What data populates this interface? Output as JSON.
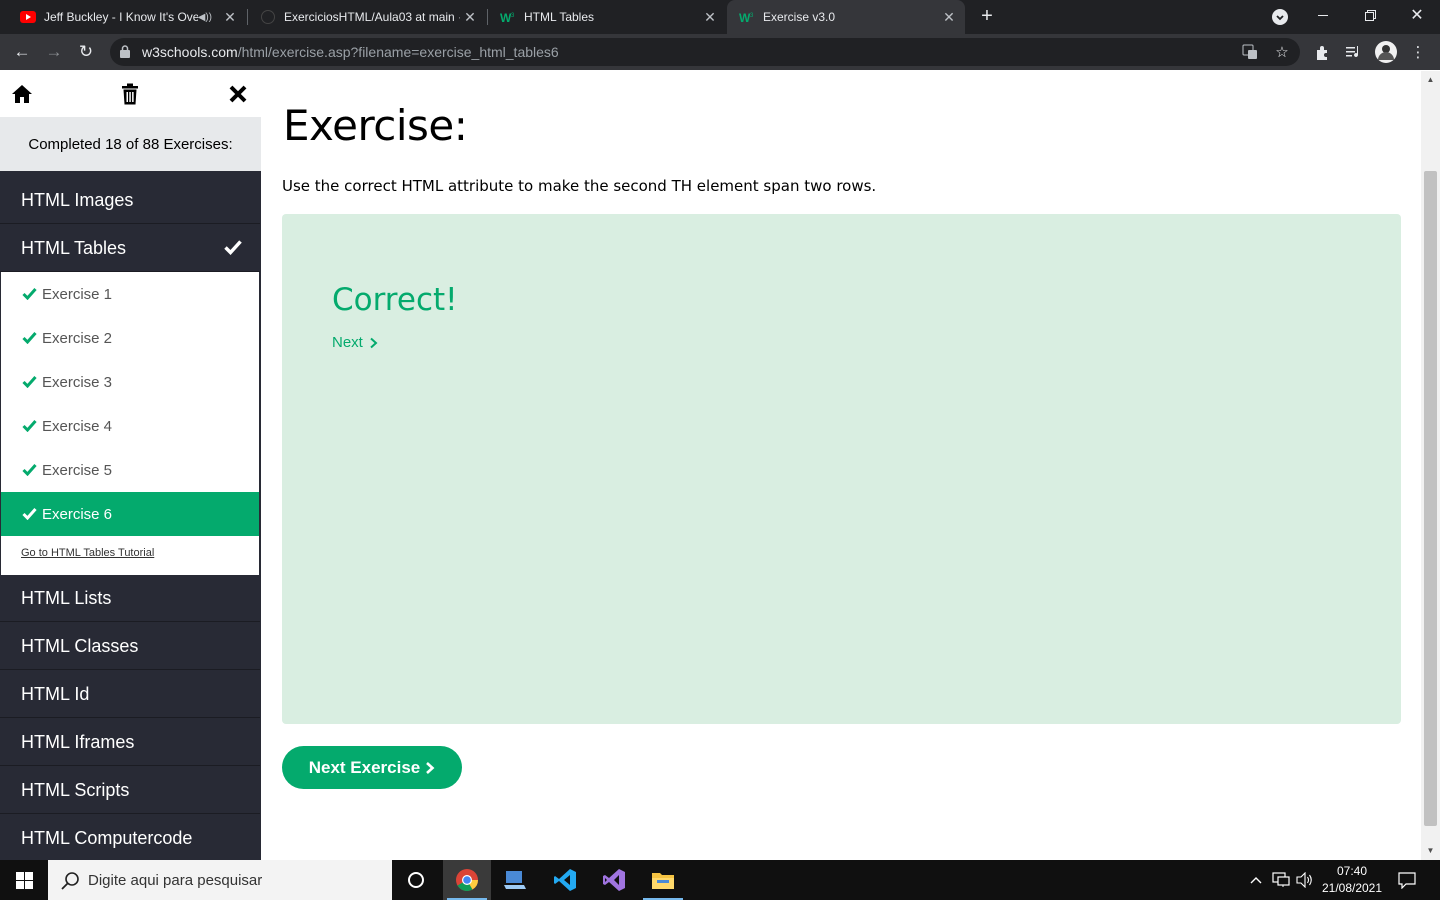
{
  "browser": {
    "tabs": [
      {
        "title": "Jeff Buckley - I Know It's Ove",
        "favicon": "youtube-icon",
        "playing_audio": true,
        "active": false
      },
      {
        "title": "ExerciciosHTML/Aula03 at main ·",
        "favicon": "github-icon",
        "active": false
      },
      {
        "title": "HTML Tables",
        "favicon": "w3schools-icon",
        "active": false
      },
      {
        "title": "Exercise v3.0",
        "favicon": "w3schools-icon",
        "active": true
      }
    ],
    "url_domain": "w3schools.com",
    "url_path": "/html/exercise.asp?filename=exercise_html_tables6"
  },
  "sidebar": {
    "progress_text": "Completed 18 of 88 Exercises:",
    "categories_before": [
      {
        "label": "HTML Images",
        "completed": false
      },
      {
        "label": "HTML Tables",
        "completed": true
      }
    ],
    "exercises": [
      {
        "label": "Exercise 1",
        "done": true,
        "active": false
      },
      {
        "label": "Exercise 2",
        "done": true,
        "active": false
      },
      {
        "label": "Exercise 3",
        "done": true,
        "active": false
      },
      {
        "label": "Exercise 4",
        "done": true,
        "active": false
      },
      {
        "label": "Exercise 5",
        "done": true,
        "active": false
      },
      {
        "label": "Exercise 6",
        "done": true,
        "active": true
      }
    ],
    "tutorial_link": "Go to HTML Tables Tutorial",
    "categories_after": [
      {
        "label": "HTML Lists"
      },
      {
        "label": "HTML Classes"
      },
      {
        "label": "HTML Id"
      },
      {
        "label": "HTML Iframes"
      },
      {
        "label": "HTML Scripts"
      },
      {
        "label": "HTML Computercode"
      }
    ]
  },
  "main": {
    "heading": "Exercise:",
    "instructions": "Use the correct HTML attribute to make the second TH element span two rows.",
    "result_title": "Correct!",
    "next_link": "Next",
    "next_exercise_button": "Next Exercise"
  },
  "taskbar": {
    "search_placeholder": "Digite aqui para pesquisar",
    "time": "07:40",
    "date": "21/08/2021"
  },
  "colors": {
    "accent_green": "#04aa6d",
    "sidebar_bg": "#282a35",
    "result_bg": "#d9eee1"
  }
}
